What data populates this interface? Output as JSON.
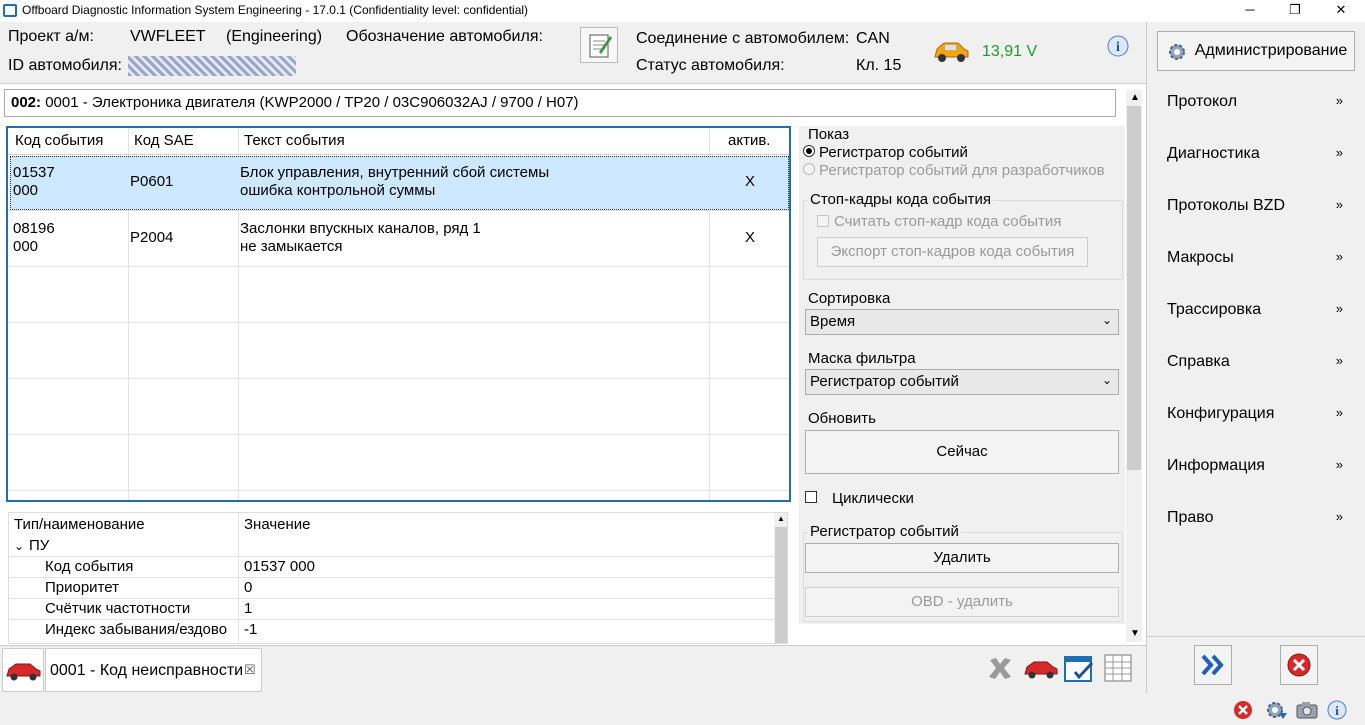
{
  "window": {
    "title": "Offboard Diagnostic Information System Engineering - 17.0.1 (Confidentiality level: confidential)",
    "minimize": "─",
    "maximize": "❐",
    "close": "✕"
  },
  "header": {
    "project_label": "Проект а/м:",
    "project_value": "VWFLEET",
    "mode_value": "(Engineering)",
    "vehicle_designation_label": "Обозначение автомобиля:",
    "vehicle_id_label": "ID автомобиля:",
    "connection_label": "Соединение с автомобилем:",
    "connection_value": "CAN",
    "status_label": "Статус автомобиля:",
    "status_value": "Кл. 15",
    "voltage": "13,91 V",
    "admin_button": "Администрирование"
  },
  "module": {
    "code": "002:",
    "text": "0001 - Электроника двигателя  (KWP2000 / TP20 / 03C906032AJ / 9700 / H07)"
  },
  "events_table": {
    "columns": [
      "Код события",
      "Код SAE",
      "Текст события",
      "актив."
    ],
    "rows": [
      {
        "code1": "01537",
        "code2": "000",
        "sae": "P0601",
        "text1": "Блок управления, внутренний сбой системы",
        "text2": "ошибка контрольной суммы",
        "active": "X"
      },
      {
        "code1": "08196",
        "code2": "000",
        "sae": "P2004",
        "text1": "Заслонки впускных каналов, ряд 1",
        "text2": "не замыкается",
        "active": "X"
      }
    ]
  },
  "display": {
    "label": "Показ",
    "opt1": "Регистратор событий",
    "opt2": "Регистратор событий для разработчиков",
    "freeze_group": "Стоп-кадры кода события",
    "freeze_check": "Считать стоп-кадр кода события",
    "freeze_export": "Экспорт стоп-кадров кода события",
    "sort_label": "Сортировка",
    "sort_value": "Время",
    "filter_label": "Маска фильтра",
    "filter_value": "Регистратор событий",
    "refresh_label": "Обновить",
    "now_button": "Сейчас",
    "cyclic_label": "Циклически",
    "register_label": "Регистратор событий",
    "delete_button": "Удалить",
    "obd_delete_button": "OBD - удалить"
  },
  "props": {
    "col1": "Тип/наименование",
    "col2": "Значение",
    "group": "ПУ",
    "rows": [
      {
        "name": "Код события",
        "value": "01537 000"
      },
      {
        "name": "Приоритет",
        "value": "0"
      },
      {
        "name": "Счётчик частотности",
        "value": "1"
      },
      {
        "name": "Индекс забывания/ездово",
        "value": "-1"
      }
    ]
  },
  "bottom_tab": {
    "label": "0001 - Код неисправности",
    "close": "☒"
  },
  "sidebar": {
    "items": [
      "Протокол",
      "Диагностика",
      "Протоколы BZD",
      "Макросы",
      "Трассировка",
      "Справка",
      "Конфигурация",
      "Информация",
      "Право"
    ],
    "chevron": "»"
  },
  "colors": {
    "accent": "#1f6fb0",
    "selection": "#cde8ff",
    "voltage": "#1a9c2b",
    "danger": "#d62a2a"
  }
}
